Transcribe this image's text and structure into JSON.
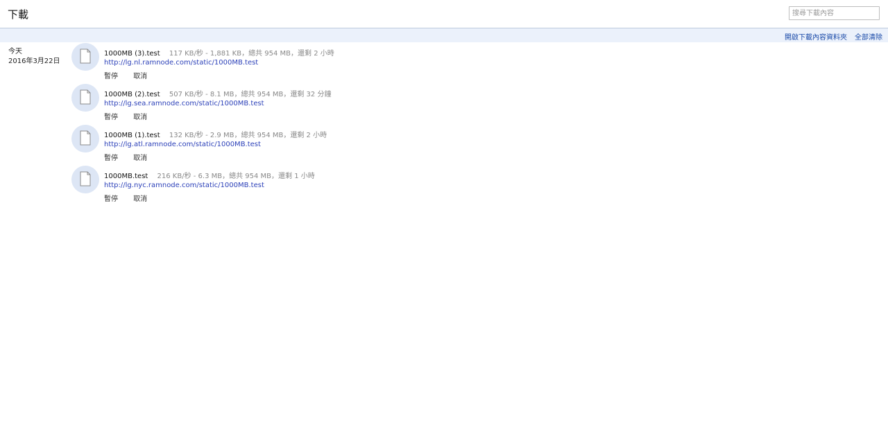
{
  "header": {
    "title": "下載",
    "search_placeholder": "搜尋下載內容"
  },
  "toolbar": {
    "open_folder": "開啟下載內容資料夾",
    "clear_all": "全部清除"
  },
  "date_group": {
    "label_today": "今天",
    "label_date": "2016年3月22日"
  },
  "downloads": [
    {
      "file_name": "1000MB (3).test",
      "status": "117 KB/秒 - 1,881 KB，總共 954 MB，還剩 2 小時",
      "url": "http://lg.nl.ramnode.com/static/1000MB.test",
      "pause": "暫停",
      "cancel": "取消",
      "icon": "file-icon"
    },
    {
      "file_name": "1000MB (2).test",
      "status": "507 KB/秒 - 8.1 MB，總共 954 MB，還剩 32 分鐘",
      "url": "http://lg.sea.ramnode.com/static/1000MB.test",
      "pause": "暫停",
      "cancel": "取消",
      "icon": "file-icon"
    },
    {
      "file_name": "1000MB (1).test",
      "status": "132 KB/秒 - 2.9 MB，總共 954 MB，還剩 2 小時",
      "url": "http://lg.atl.ramnode.com/static/1000MB.test",
      "pause": "暫停",
      "cancel": "取消",
      "icon": "file-icon"
    },
    {
      "file_name": "1000MB.test",
      "status": "216 KB/秒 - 6.3 MB，總共 954 MB，還剩 1 小時",
      "url": "http://lg.nyc.ramnode.com/static/1000MB.test",
      "pause": "暫停",
      "cancel": "取消",
      "icon": "file-icon"
    }
  ],
  "colors": {
    "toolbar_bg": "#ebf1fb",
    "link": "#2a3fb8",
    "icon_circle": "#dde6f5"
  }
}
